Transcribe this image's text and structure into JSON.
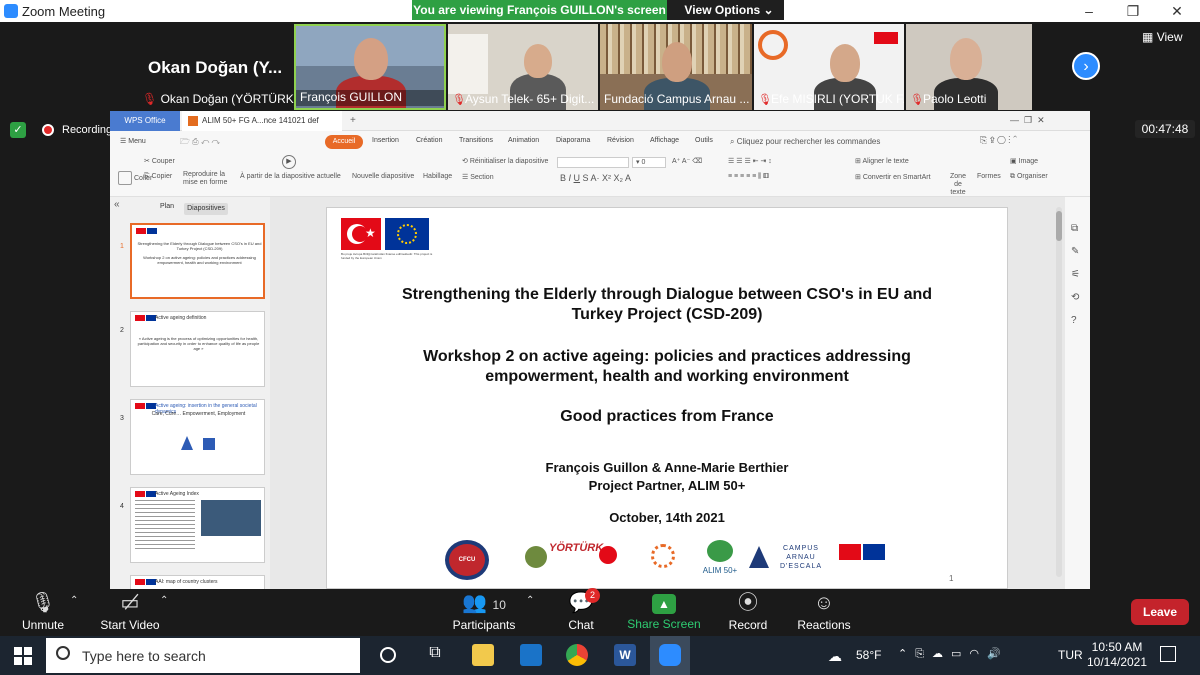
{
  "window": {
    "title": "Zoom Meeting",
    "viewing_banner": "You are viewing François GUILLON's screen",
    "view_options": "View Options",
    "view_button": "View"
  },
  "participants": [
    {
      "big_name": "Okan Doğan (Y...",
      "name": "Okan Doğan (YÖRTÜRK)"
    },
    {
      "name": "François GUILLON"
    },
    {
      "name": "Aysun Telek- 65+ Digit..."
    },
    {
      "name": "Fundació Campus Arnau ..."
    },
    {
      "name": "Efe MISIRLI (YORTUK F..."
    },
    {
      "name": "Paolo Leotti"
    }
  ],
  "recording_label": "Recording",
  "timer": "00:47:48",
  "wps": {
    "app_tab": "WPS Office",
    "doc_tab": "ALIM 50+ FG  A...nce 141021 def",
    "ribbon_tabs": [
      "Menu",
      "Accueil",
      "Insertion",
      "Création",
      "Transitions",
      "Animation",
      "Diaporama",
      "Révision",
      "Affichage",
      "Outils"
    ],
    "search_placeholder": "Cliquez pour rechercher les commandes",
    "toolbar": {
      "couper": "Couper",
      "copier": "Copier",
      "coller": "Coller",
      "reproduire": "Reproduire la mise en forme",
      "a_partir": "À partir de la diapositive actuelle",
      "nouvelle": "Nouvelle diapositive",
      "habillage": "Habillage",
      "reinit": "Réinitialiser la diapositive",
      "section": "Section",
      "aligner": "Aligner le texte",
      "convertir": "Convertir en SmartArt",
      "zone": "Zone de texte",
      "formes": "Formes",
      "image": "Image",
      "organiser": "Organiser",
      "font_size": "0"
    },
    "pane_tabs": {
      "plan": "Plan",
      "diapositives": "Diapositives"
    },
    "thumbs": [
      {
        "num": "1",
        "title": "Strengthening the Elderly through Dialogue between CSO's in EU and Turkey Project (CSD-209)",
        "sub": "Workshop 2 on active ageing: policies and practices addressing empowerment, health and working environment"
      },
      {
        "num": "2",
        "title": "Active ageing definition",
        "sub": "« Active ageing is the process of optimizing opportunities for health, participation and security in order to enhance quality of life as people age »"
      },
      {
        "num": "3",
        "title": "Active ageing: insertion in the general societal dynamics",
        "sub": "Care, Cure… Empowerment, Employment"
      },
      {
        "num": "4",
        "title": "Active Ageing Index",
        "sub": ""
      },
      {
        "num": "5",
        "title": "AAI: map of country clusters",
        "sub": ""
      }
    ]
  },
  "slide": {
    "funded_note": "Bu proje Avrupa Birliği tarafından finanse edilmektedir. This project is funded by the European Union",
    "title1": "Strengthening the Elderly through Dialogue between CSO's in EU and",
    "title2": "Turkey Project (CSD-209)",
    "ws1": "Workshop 2 on active ageing: policies and practices addressing",
    "ws2": "empowerment, health and working environment",
    "good": "Good practices from France",
    "authors": "François Guillon & Anne-Marie Berthier",
    "partner": "Project Partner, ALIM 50+",
    "date": "October, 14th 2021",
    "page_number": "1",
    "logos": {
      "cfcu": "CFCU",
      "yorturk": "YÖRTÜRK",
      "alim": "ALIM 50+",
      "campus": "CAMPUS ARNAU D'ESCALA"
    }
  },
  "zoom_bar": {
    "unmute": "Unmute",
    "video": "Start Video",
    "participants": "Participants",
    "participants_count": "10",
    "chat": "Chat",
    "chat_badge": "2",
    "share": "Share Screen",
    "record": "Record",
    "reactions": "Reactions",
    "leave": "Leave"
  },
  "taskbar": {
    "search_placeholder": "Type here to search",
    "weather": "58°F",
    "lang": "TUR",
    "time": "10:50 AM",
    "date": "10/14/2021"
  }
}
